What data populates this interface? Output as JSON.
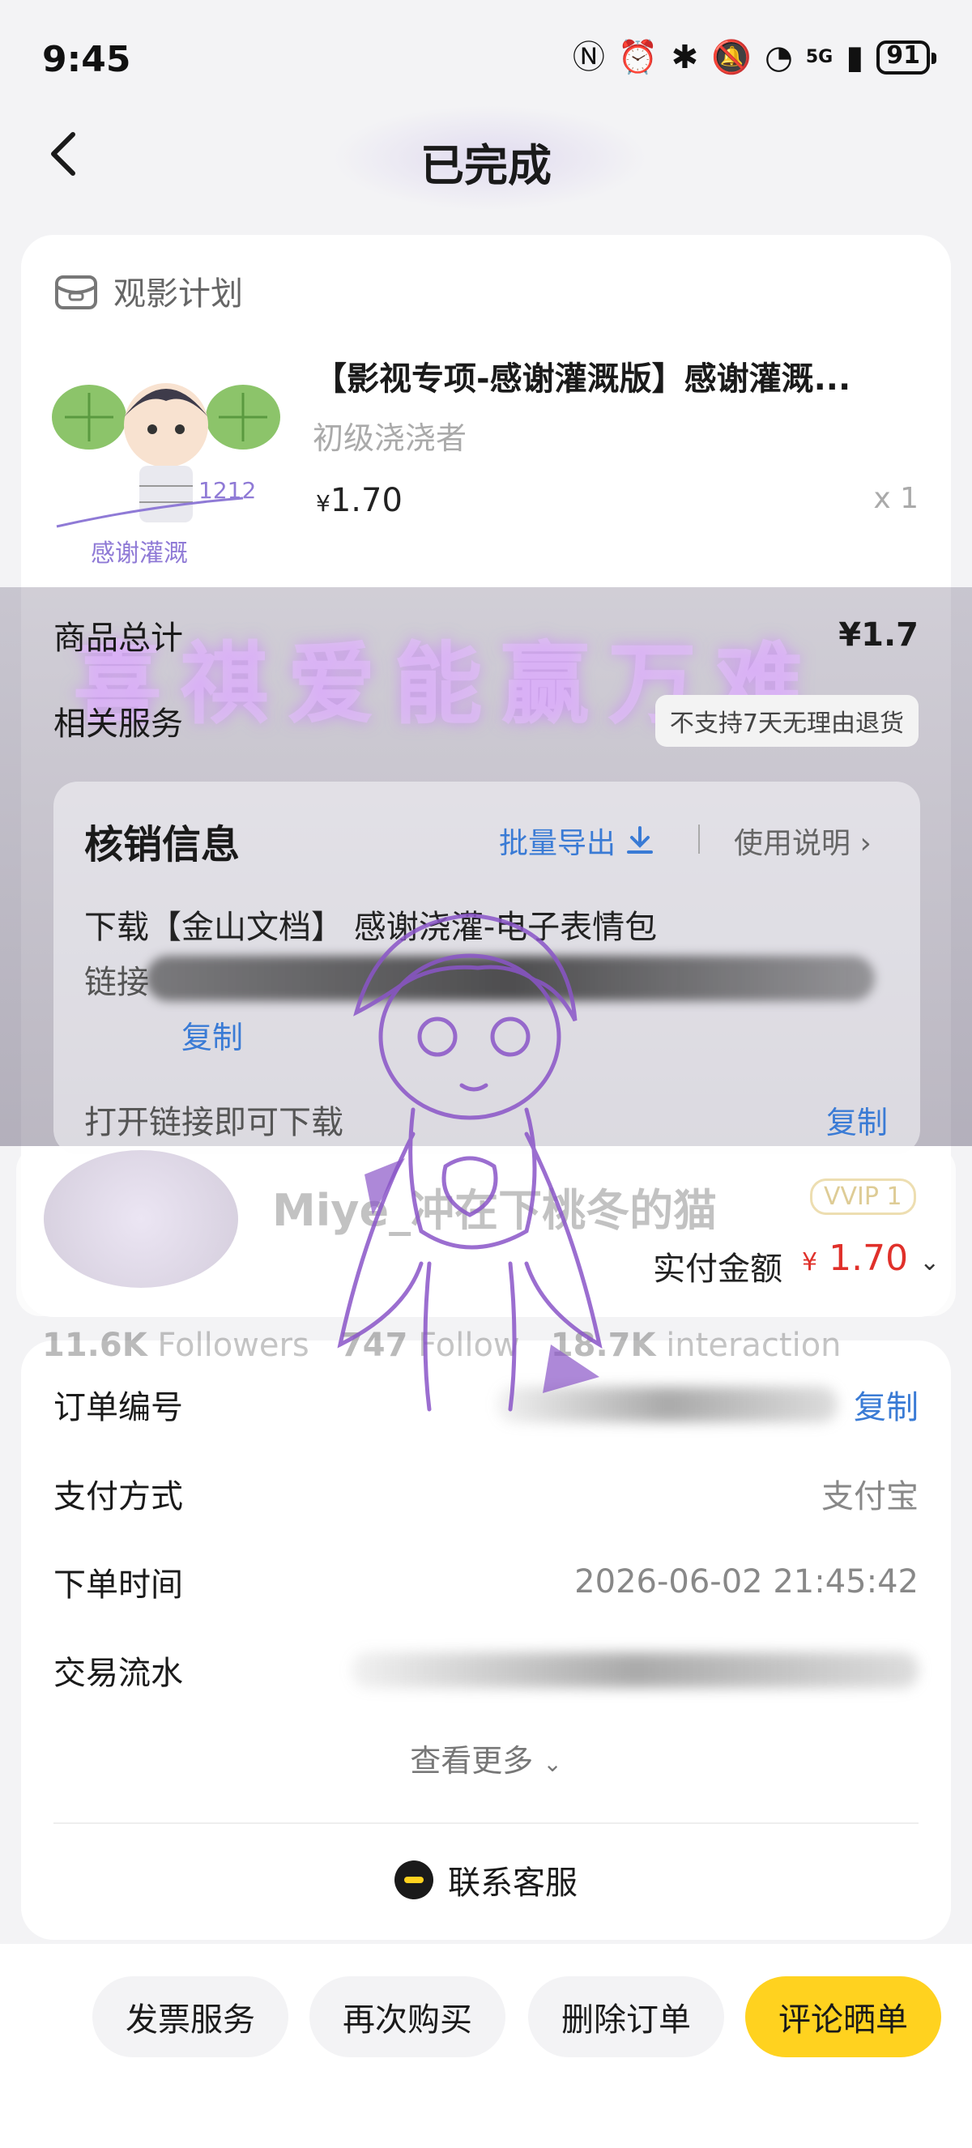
{
  "status_bar": {
    "time": "9:45",
    "network": "5G",
    "battery": "91"
  },
  "header": {
    "title": "已完成"
  },
  "product_card": {
    "section_label": "观影计划",
    "product_name": "【影视专项-感谢灌溉版】感谢灌溉...",
    "spec": "初级浇浇者",
    "price_symbol": "¥",
    "price": "1.70",
    "quantity": "x 1",
    "thumb_caption": "感谢灌溉"
  },
  "summary": {
    "total_label": "商品总计",
    "total_value": "¥1.7",
    "service_label": "相关服务",
    "service_value": "不支持7天无理由退货"
  },
  "overlay": {
    "banner_text": "喜祺爱能赢万难"
  },
  "verify": {
    "title": "核销信息",
    "export_label": "批量导出",
    "usage_label": "使用说明",
    "line1": "下载【金山文档】 感谢浇灌-电子表情包",
    "line2_prefix": "链接",
    "copy_label_1": "复制",
    "line3": "打开链接即可下载",
    "copy_label_2": "复制"
  },
  "profile": {
    "name": "Miye_冲在下桃冬的猫",
    "vip": "VVIP 1",
    "followers_count": "11.6K",
    "followers_label": "Followers",
    "following_count": "747",
    "following_label": "Follow",
    "interaction_count": "18.7K",
    "interaction_label": "interaction"
  },
  "payment": {
    "paid_label": "实付金额",
    "paid_symbol": "¥",
    "paid_amount": "1.70"
  },
  "order_info": {
    "order_no_label": "订单编号",
    "order_copy": "复制",
    "pay_method_label": "支付方式",
    "pay_method_value": "支付宝",
    "order_time_label": "下单时间",
    "order_time_value": "2026-06-02 21:45:42",
    "transaction_label": "交易流水",
    "see_more": "查看更多",
    "contact_service": "联系客服"
  },
  "actions": {
    "invoice": "发票服务",
    "rebuy": "再次购买",
    "delete": "删除订单",
    "review": "评论晒单"
  },
  "colors": {
    "accent_yellow": "#ffd21f",
    "price_red": "#e0302a",
    "link_blue": "#3a7bd5"
  }
}
